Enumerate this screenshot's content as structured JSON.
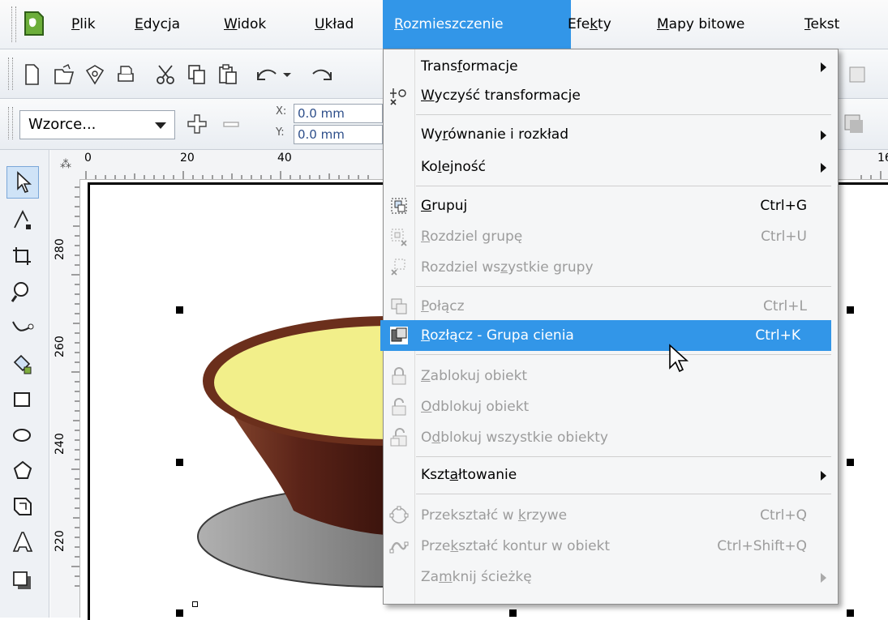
{
  "menubar": {
    "items": [
      {
        "pre": "",
        "u": "P",
        "post": "lik"
      },
      {
        "pre": "",
        "u": "E",
        "post": "dycja"
      },
      {
        "pre": "",
        "u": "W",
        "post": "idok"
      },
      {
        "pre": "",
        "u": "U",
        "post": "kład"
      },
      {
        "pre": "",
        "u": "R",
        "post": "ozmieszczenie"
      },
      {
        "pre": "Efe",
        "u": "k",
        "post": "ty"
      },
      {
        "pre": "",
        "u": "M",
        "post": "apy bitowe"
      },
      {
        "pre": "",
        "u": "T",
        "post": "ekst"
      }
    ],
    "active_index": 4
  },
  "property_bar": {
    "preset_value": "Wzorce...",
    "x_label": "X:",
    "y_label": "Y:",
    "x_value": "0.0 mm",
    "y_value": "0.0 mm"
  },
  "rulers": {
    "horizontal": [
      "0",
      "20",
      "40",
      "16"
    ],
    "vertical": [
      "280",
      "260",
      "240",
      "220"
    ]
  },
  "dropdown": {
    "items": [
      {
        "pre": "Trans",
        "u": "f",
        "post": "ormacje",
        "shortcut": "",
        "submenu": true,
        "disabled": false,
        "icon": ""
      },
      {
        "pre": "",
        "u": "W",
        "post": "yczyść transformacje",
        "shortcut": "",
        "submenu": false,
        "disabled": false,
        "icon": "clear-transform-icon"
      },
      {
        "pre": "Wy",
        "u": "r",
        "post": "ównanie i rozkład",
        "shortcut": "",
        "submenu": true,
        "disabled": false,
        "icon": ""
      },
      {
        "pre": "Ko",
        "u": "l",
        "post": "ejność",
        "shortcut": "",
        "submenu": true,
        "disabled": false,
        "icon": ""
      },
      {
        "pre": "",
        "u": "G",
        "post": "rupuj",
        "shortcut": "Ctrl+G",
        "submenu": false,
        "disabled": false,
        "icon": "group-icon"
      },
      {
        "pre": "",
        "u": "R",
        "post": "ozdziel grupę",
        "shortcut": "Ctrl+U",
        "submenu": false,
        "disabled": true,
        "icon": "ungroup-icon"
      },
      {
        "pre": "Rozdziel ws",
        "u": "z",
        "post": "ystkie grupy",
        "shortcut": "",
        "submenu": false,
        "disabled": true,
        "icon": "ungroup-all-icon"
      },
      {
        "pre": "",
        "u": "P",
        "post": "ołącz",
        "shortcut": "Ctrl+L",
        "submenu": false,
        "disabled": true,
        "icon": "combine-icon"
      },
      {
        "pre": "",
        "u": "R",
        "post": "ozłącz - Grupa cienia",
        "shortcut": "Ctrl+K",
        "submenu": false,
        "disabled": false,
        "icon": "break-apart-icon",
        "highlighted": true
      },
      {
        "pre": "",
        "u": "Z",
        "post": "ablokuj obiekt",
        "shortcut": "",
        "submenu": false,
        "disabled": true,
        "icon": "lock-icon"
      },
      {
        "pre": "",
        "u": "O",
        "post": "dblokuj obiekt",
        "shortcut": "",
        "submenu": false,
        "disabled": true,
        "icon": "unlock-icon"
      },
      {
        "pre": "O",
        "u": "d",
        "post": "blokuj wszystkie obiekty",
        "shortcut": "",
        "submenu": false,
        "disabled": true,
        "icon": "unlock-all-icon"
      },
      {
        "pre": "Kszt",
        "u": "a",
        "post": "łtowanie",
        "shortcut": "",
        "submenu": true,
        "disabled": false,
        "icon": ""
      },
      {
        "pre": "Przekształć w ",
        "u": "k",
        "post": "rzywe",
        "shortcut": "Ctrl+Q",
        "submenu": false,
        "disabled": true,
        "icon": "convert-curves-icon"
      },
      {
        "pre": "Prze",
        "u": "k",
        "post": "ształć kontur w obiekt",
        "shortcut": "Ctrl+Shift+Q",
        "submenu": false,
        "disabled": true,
        "icon": "outline-to-object-icon"
      },
      {
        "pre": "Za",
        "u": "m",
        "post": "knij ścieżkę",
        "shortcut": "",
        "submenu": true,
        "disabled": true,
        "icon": ""
      }
    ]
  },
  "colors": {
    "highlight": "#3296e8",
    "bowl_fill": "#f2ef8a",
    "bowl_rim": "#6b2f1c",
    "shadow": "#8a8a8a"
  }
}
